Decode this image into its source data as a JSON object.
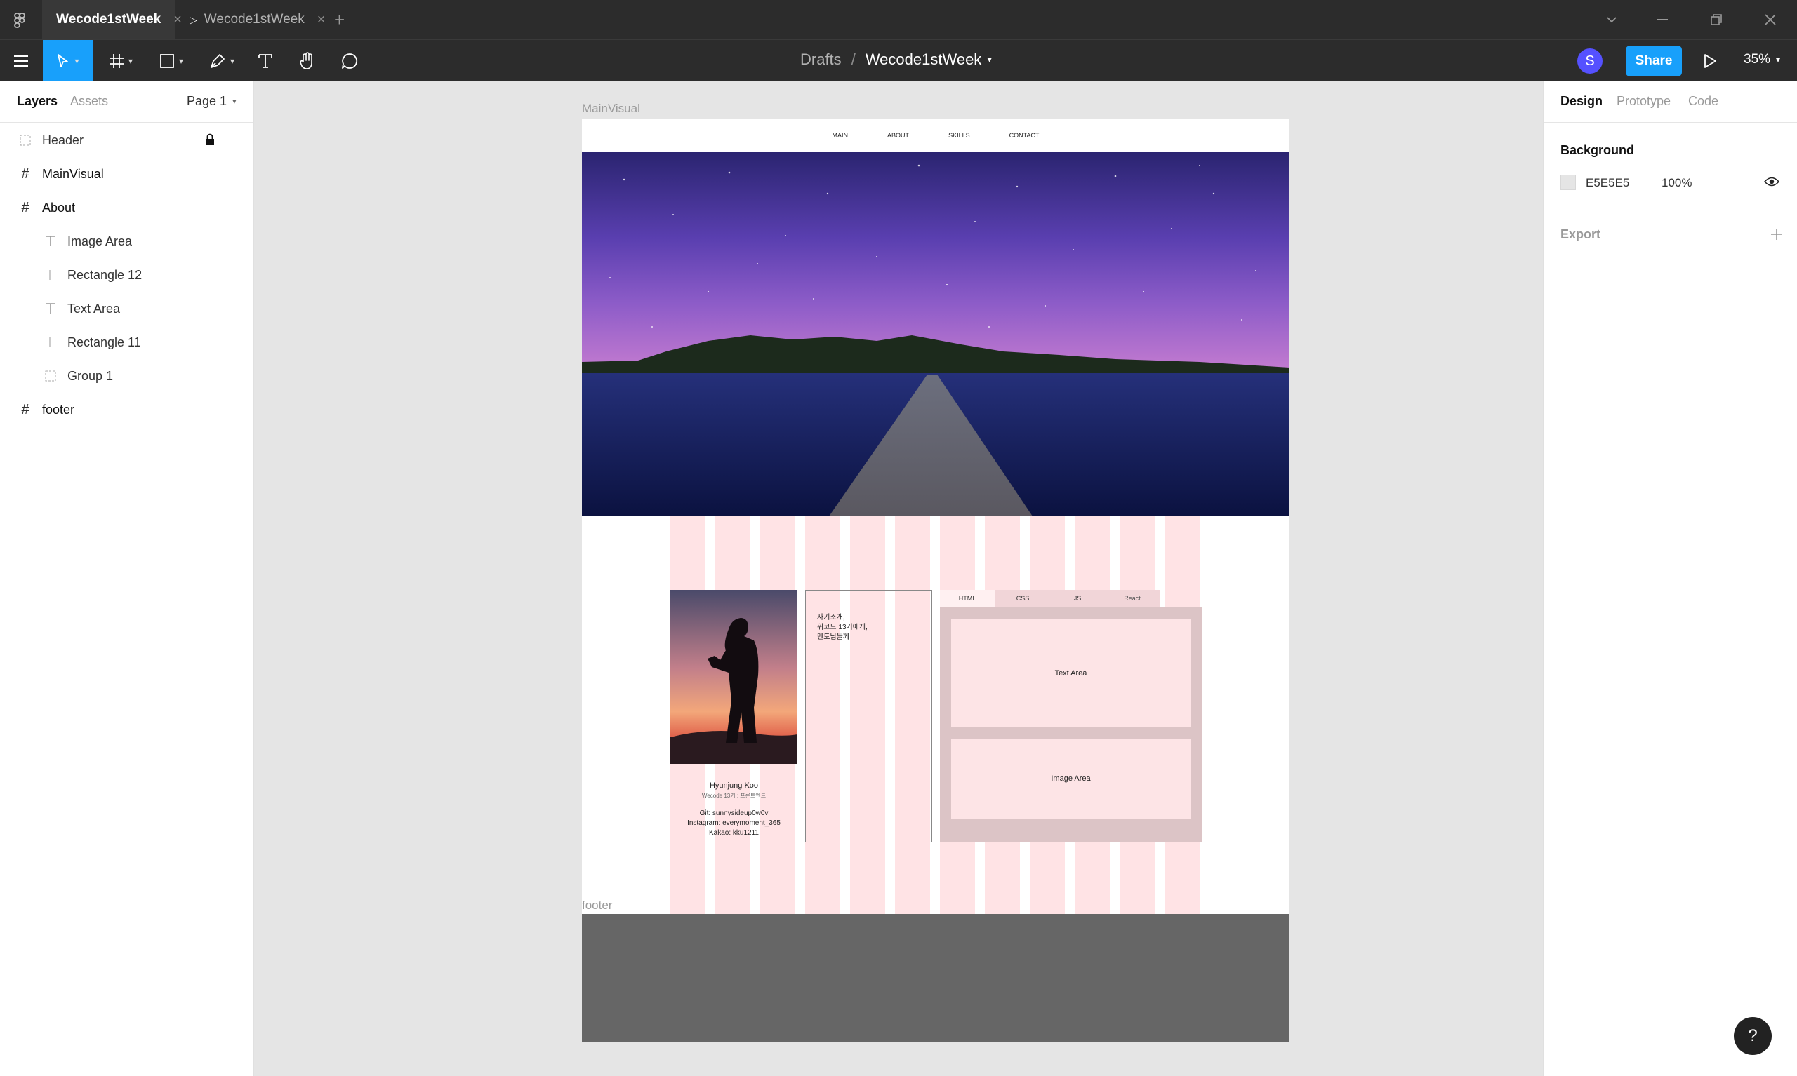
{
  "titlebar": {
    "tabs": [
      {
        "label": "Wecode1stWeek",
        "close": "×"
      },
      {
        "label": "Wecode1stWeek",
        "close": "×"
      }
    ],
    "new_tab": "+"
  },
  "toolbar": {
    "breadcrumb_root": "Drafts",
    "breadcrumb_sep": "/",
    "file_name": "Wecode1stWeek",
    "avatar_initial": "S",
    "share_label": "Share",
    "zoom": "35%"
  },
  "left_panel": {
    "tabs": [
      "Layers",
      "Assets"
    ],
    "page_label": "Page 1",
    "layers": [
      {
        "name": "Header",
        "type": "group",
        "locked": true
      },
      {
        "name": "MainVisual",
        "type": "frame"
      },
      {
        "name": "About",
        "type": "frame"
      },
      {
        "name": "Image Area",
        "type": "text"
      },
      {
        "name": "Rectangle 12",
        "type": "rect"
      },
      {
        "name": "Text Area",
        "type": "text"
      },
      {
        "name": "Rectangle 11",
        "type": "rect"
      },
      {
        "name": "Group 1",
        "type": "group"
      },
      {
        "name": "footer",
        "type": "frame"
      }
    ]
  },
  "right_panel": {
    "tabs": [
      "Design",
      "Prototype",
      "Code"
    ],
    "background_title": "Background",
    "bg_hex": "E5E5E5",
    "bg_opacity": "100%",
    "export_title": "Export"
  },
  "canvas": {
    "mainvisual_label": "MainVisual",
    "footer_label": "footer",
    "nav": [
      "MAIN",
      "ABOUT",
      "SKILLS",
      "CONTACT"
    ],
    "intro_text": [
      "자기소개,",
      "위코드 13기에게,",
      "멘토님들께"
    ],
    "profile": {
      "name": "Hyunjung Koo",
      "subtitle": "Wecode 13기 : 프론트엔드",
      "git": "Git: sunnysideup0w0v",
      "instagram": "Instagram: everymoment_365",
      "kakao": "Kakao: kku1211"
    },
    "skill_tabs": [
      "HTML",
      "CSS",
      "JS",
      "React"
    ],
    "text_area_label": "Text Area",
    "image_area_label": "Image Area"
  },
  "help": "?",
  "colors": {
    "accent": "#18a0fb",
    "toolbar": "#2c2c2c",
    "avatar": "#5551ff",
    "footer": "#666666",
    "grid": "#ffc0c5"
  }
}
